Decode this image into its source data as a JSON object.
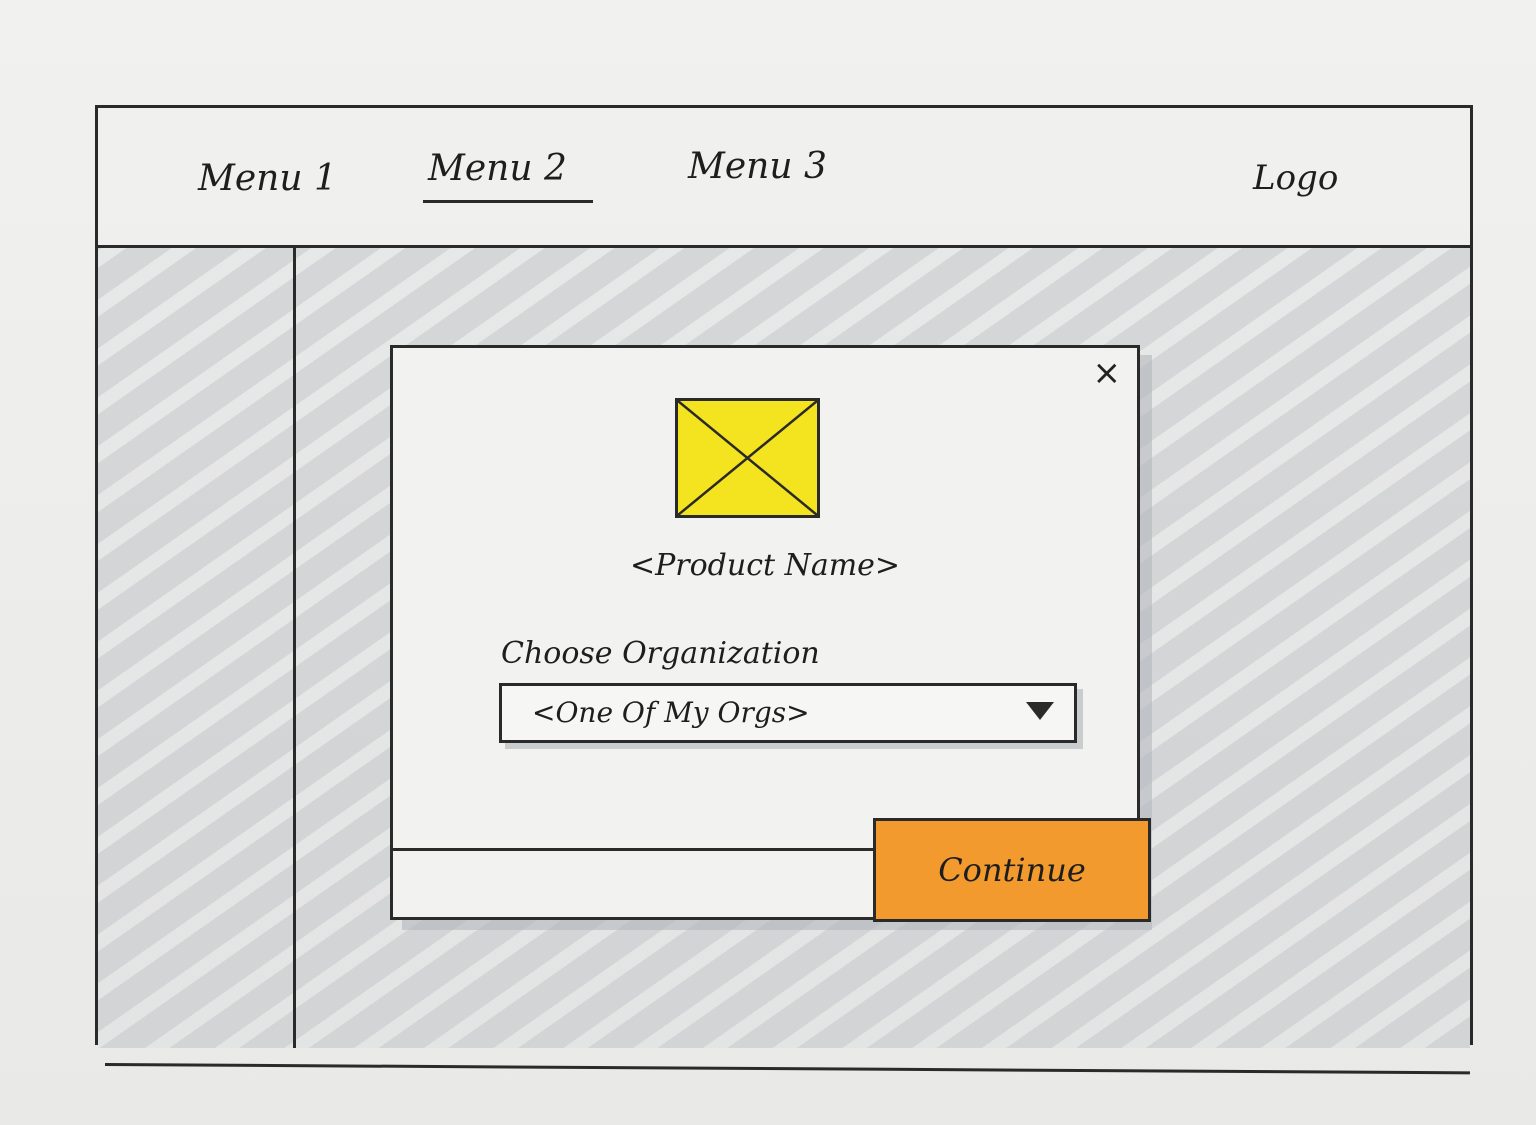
{
  "nav": {
    "items": [
      {
        "label": "Menu 1"
      },
      {
        "label": "Menu 2",
        "active": true
      },
      {
        "label": "Menu 3"
      }
    ],
    "logo": "Logo"
  },
  "modal": {
    "close_icon": "×",
    "product_image_icon": "image-placeholder-icon",
    "product_name": "<Product Name>",
    "field_label": "Choose Organization",
    "org_select": {
      "value": "<One Of My Orgs>",
      "icon": "dropdown-arrow-icon"
    },
    "continue_label": "Continue"
  },
  "colors": {
    "product_image_fill": "#f4e420",
    "button_fill": "#f39a2e",
    "backdrop_hatch": "#bec2c6"
  }
}
